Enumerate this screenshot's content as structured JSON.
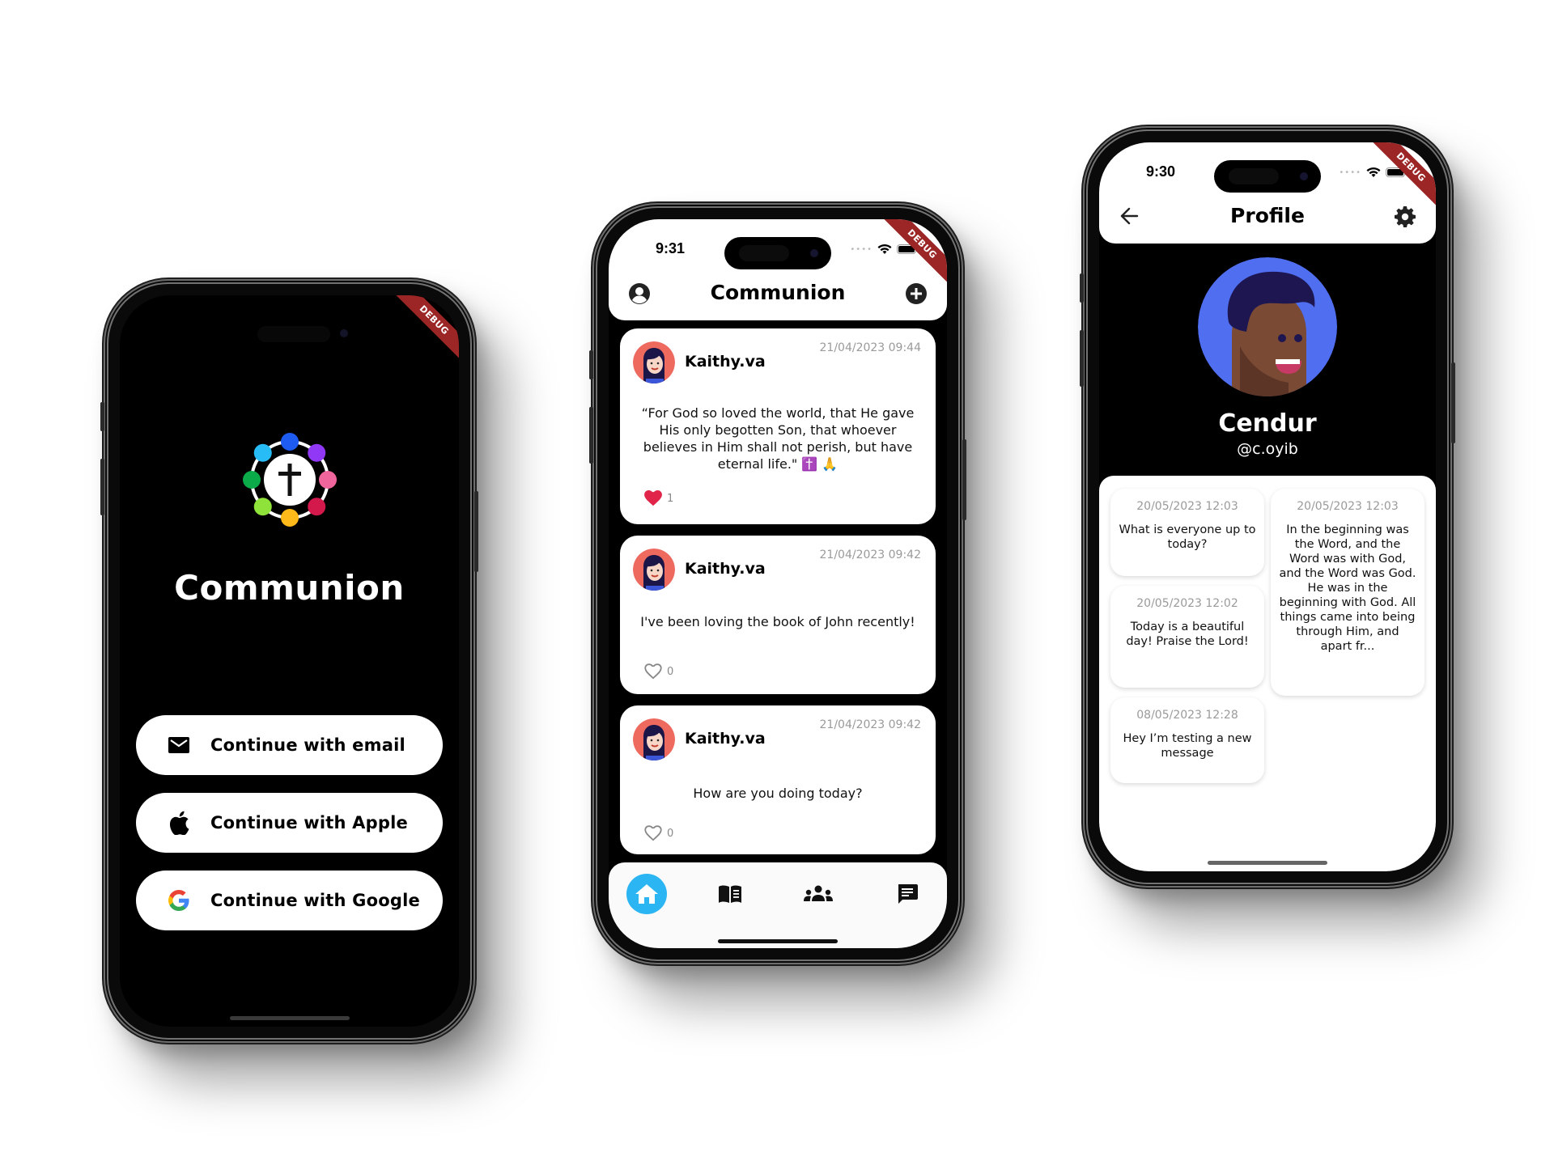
{
  "debug_banner": "DEBUG",
  "login_screen": {
    "app_name": "Communion",
    "logo_dot_colors": [
      "#1e5bf0",
      "#9038f5",
      "#f0659b",
      "#d3184c",
      "#fdb81a",
      "#8ee23a",
      "#0aab48",
      "#27bcf5"
    ],
    "buttons": [
      {
        "label": "Continue with email",
        "icon": "envelope-icon"
      },
      {
        "label": "Continue with Apple",
        "icon": "apple-icon"
      },
      {
        "label": "Continue with Google",
        "icon": "google-icon"
      }
    ]
  },
  "feed_screen": {
    "status_time": "9:31",
    "title": "Communion",
    "left_icon": "profile-icon",
    "right_icon": "add-post-icon",
    "posts": [
      {
        "username": "Kaithy.va",
        "timestamp": "21/04/2023 09:44",
        "body": "“For God so loved the world, that He gave His only begotten Son, that whoever believes in Him shall not perish, but have eternal life.\" ✝️ 🙏",
        "likes": "1",
        "liked": true
      },
      {
        "username": "Kaithy.va",
        "timestamp": "21/04/2023 09:42",
        "body": "I've been loving the book of John recently!",
        "likes": "0",
        "liked": false
      },
      {
        "username": "Kaithy.va",
        "timestamp": "21/04/2023 09:42",
        "body": "How are you doing today?",
        "likes": "0",
        "liked": false
      }
    ],
    "nav": [
      {
        "name": "home",
        "icon": "home-icon",
        "active": true
      },
      {
        "name": "bible",
        "icon": "book-icon",
        "active": false
      },
      {
        "name": "groups",
        "icon": "groups-icon",
        "active": false
      },
      {
        "name": "messages",
        "icon": "chat-icon",
        "active": false
      }
    ],
    "accent_color": "#2bb5f2",
    "like_color": "#e0244a"
  },
  "profile_screen": {
    "status_time": "9:30",
    "title": "Profile",
    "left_icon": "back-arrow-icon",
    "right_icon": "settings-gear-icon",
    "name": "Cendur",
    "handle": "@c.oyib",
    "messages": [
      {
        "timestamp": "20/05/2023 12:03",
        "text": "What is everyone up to today?"
      },
      {
        "timestamp": "20/05/2023 12:02",
        "text": "Today is a beautiful day! Praise the Lord!"
      },
      {
        "timestamp": "20/05/2023 12:03",
        "text": "In the beginning was the Word, and the Word was with God, and the Word was God. He was in the beginning with God. All things came into being through Him, and apart fr..."
      },
      {
        "timestamp": "08/05/2023 12:28",
        "text": "Hey I’m testing a new message"
      }
    ]
  }
}
